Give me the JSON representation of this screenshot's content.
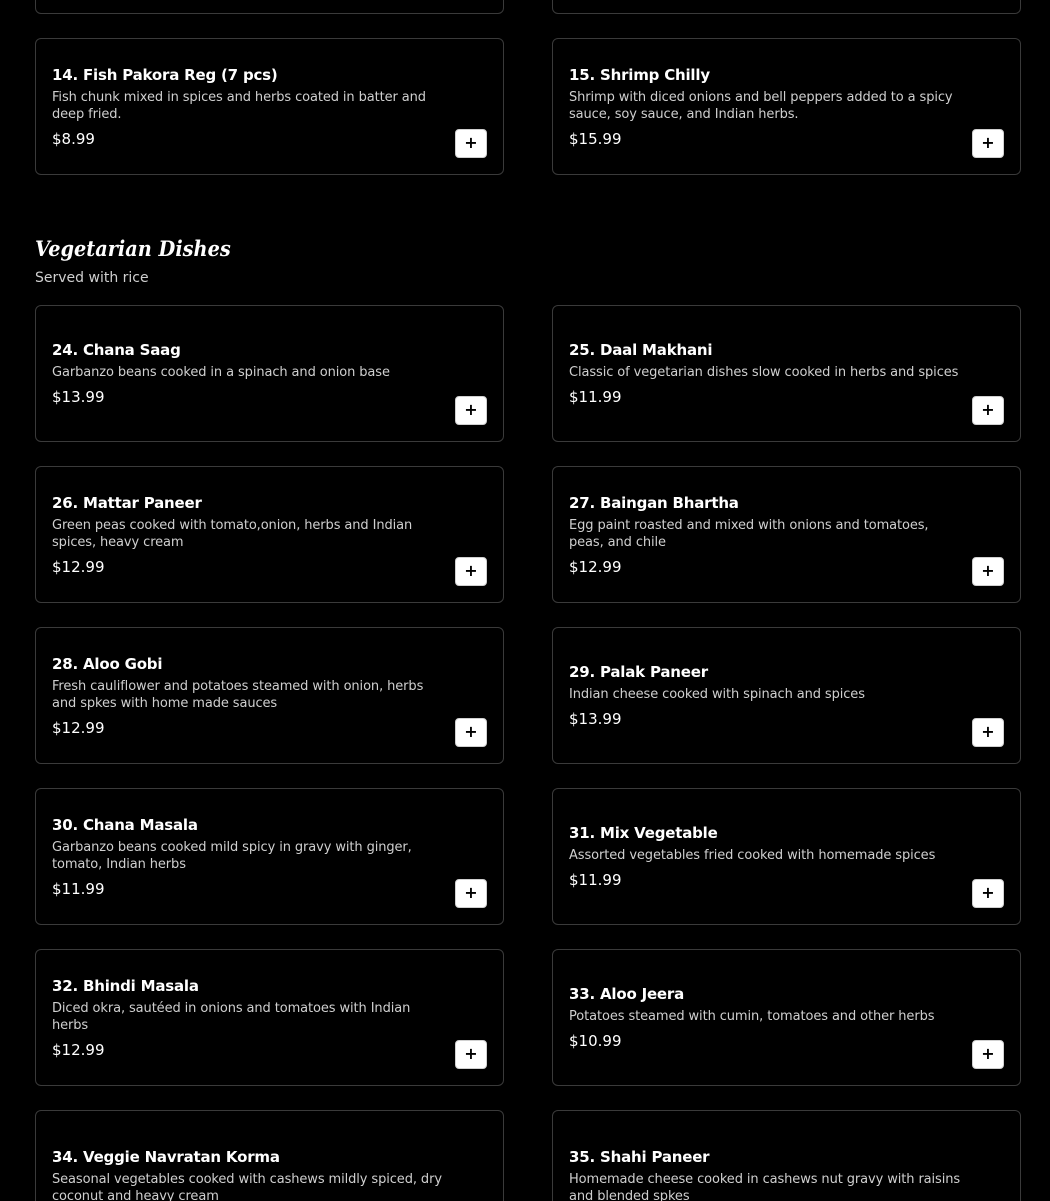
{
  "top_cards_partial": [
    {
      "name": "",
      "desc": "",
      "price": ""
    },
    {
      "name": "",
      "desc": "",
      "price": ""
    }
  ],
  "appetizers_tail": [
    {
      "name": "14. Fish Pakora Reg (7 pcs)",
      "desc": "Fish chunk mixed in spices and herbs coated in batter and deep fried.",
      "price": "$8.99"
    },
    {
      "name": "15. Shrimp Chilly",
      "desc": "Shrimp with diced onions and bell peppers added to a spicy sauce, soy sauce, and Indian herbs.",
      "price": "$15.99"
    }
  ],
  "section": {
    "title": "Vegetarian Dishes",
    "subtitle": "Served with rice"
  },
  "items": [
    {
      "name": "24. Chana Saag",
      "desc": "Garbanzo beans cooked in a spinach and onion base",
      "price": "$13.99"
    },
    {
      "name": "25. Daal Makhani",
      "desc": "Classic of vegetarian dishes slow cooked in herbs and spices",
      "price": "$11.99"
    },
    {
      "name": "26. Mattar Paneer",
      "desc": "Green peas cooked with tomato,onion, herbs and Indian spices, heavy cream",
      "price": "$12.99"
    },
    {
      "name": "27. Baingan Bhartha",
      "desc": "Egg paint roasted and mixed with onions and tomatoes, peas, and chile",
      "price": "$12.99"
    },
    {
      "name": "28. Aloo Gobi",
      "desc": "Fresh cauliflower and potatoes steamed with onion, herbs and spkes with home made sauces",
      "price": "$12.99"
    },
    {
      "name": "29. Palak Paneer",
      "desc": "Indian cheese cooked with spinach and spices",
      "price": "$13.99"
    },
    {
      "name": "30. Chana Masala",
      "desc": "Garbanzo beans cooked mild spicy in gravy with ginger, tomato, Indian herbs",
      "price": "$11.99"
    },
    {
      "name": "31. Mix Vegetable",
      "desc": "Assorted vegetables fried cooked with homemade spices",
      "price": "$11.99"
    },
    {
      "name": "32. Bhindi Masala",
      "desc": "Diced okra, sautéed in onions and tomatoes with Indian herbs",
      "price": "$12.99"
    },
    {
      "name": "33. Aloo Jeera",
      "desc": "Potatoes steamed with cumin, tomatoes and other herbs",
      "price": "$10.99"
    },
    {
      "name": "34. Veggie Navratan Korma",
      "desc": "Seasonal vegetables cooked with cashews mildly spiced, dry coconut and heavy cream",
      "price": ""
    },
    {
      "name": "35. Shahi Paneer",
      "desc": "Homemade cheese cooked in cashews nut gravy with raisins and blended spkes",
      "price": ""
    }
  ],
  "add_icon": "plus-icon"
}
